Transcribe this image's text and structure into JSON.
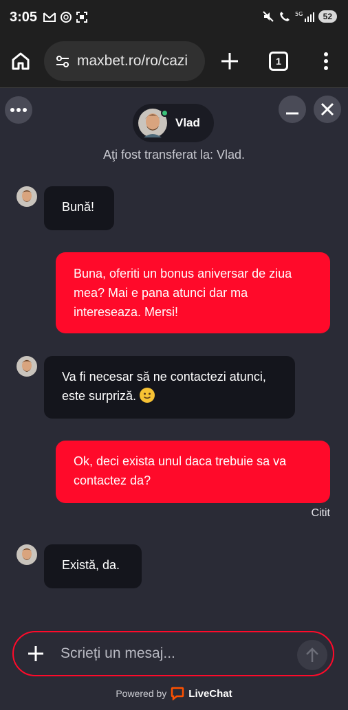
{
  "status_bar": {
    "time": "3:05",
    "battery": "52",
    "icons": [
      "gmail-icon",
      "chatgpt-icon",
      "screenshot-icon",
      "mute-icon",
      "wifi-call-icon",
      "5g-signal-icon",
      "battery-icon"
    ]
  },
  "browser": {
    "url": "maxbet.ro/ro/cazi",
    "tab_count": "1"
  },
  "chat": {
    "agent_name": "Vlad",
    "transfer_note": "Aţi fost transferat la: Vlad.",
    "messages": [
      {
        "from": "agent",
        "text": "Bună!"
      },
      {
        "from": "user",
        "text": "Buna, oferiti un bonus aniversar de ziua mea? Mai e pana atunci dar ma intereseaza. Mersi!"
      },
      {
        "from": "agent",
        "text": "Va fi necesar să ne contactezi atunci, este surpriză."
      },
      {
        "from": "user",
        "text": "Ok, deci exista unul daca trebuie sa va contactez da?"
      },
      {
        "from": "agent",
        "text": "Există, da."
      }
    ],
    "read_status": "Citit",
    "composer_placeholder": "Scrieți un mesaj...",
    "powered_by": "Powered by",
    "brand": "LiveChat"
  },
  "colors": {
    "accent": "#ff0a2a",
    "background": "#2a2b36",
    "agent_bubble": "#14151c",
    "online": "#3bc47a"
  }
}
